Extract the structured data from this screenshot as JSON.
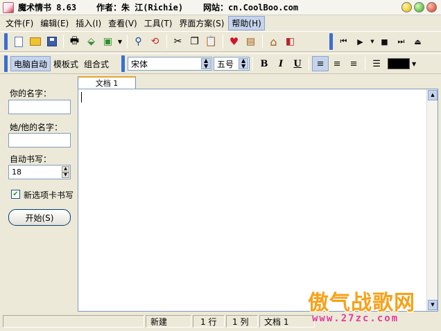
{
  "window": {
    "title": "魔术情书 8.63    作者：朱 江(Richie)    网站：cn.CoolBoo.com"
  },
  "menu": {
    "items": [
      "文件(F)",
      "编辑(E)",
      "插入(I)",
      "查看(V)",
      "工具(T)",
      "界面方案(S)",
      "帮助(H)"
    ]
  },
  "toolbar_mode": {
    "modes": [
      "电脑自动",
      "模板式",
      "组合式"
    ]
  },
  "format": {
    "font_name": "宋体",
    "font_size": "五号",
    "bold": "B",
    "italic": "I",
    "underline": "U",
    "text_color": "#000000"
  },
  "left_panel": {
    "your_name_label": "你的名字：",
    "your_name_value": "",
    "their_name_label": "她/他的名字：",
    "their_name_value": "",
    "auto_write_label": "自动书写：",
    "auto_write_value": "18",
    "new_tab_label": "新选项卡书写",
    "new_tab_checked": true,
    "start_button": "开始(S)"
  },
  "editor": {
    "tab_label": "文档 1",
    "content": ""
  },
  "status": {
    "state": "新建",
    "line": "1 行",
    "col": "1 列",
    "doc": "文档 1"
  },
  "watermark": {
    "title": "傲气战歌网",
    "url": "www.27zc.com"
  }
}
